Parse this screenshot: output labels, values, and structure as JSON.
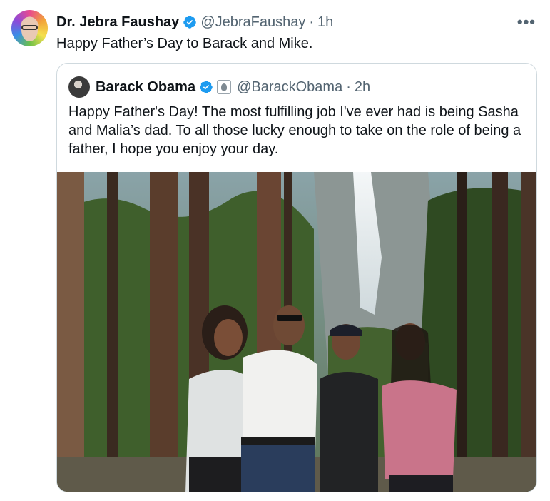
{
  "tweet": {
    "author_name": "Dr. Jebra Faushay",
    "handle": "@JebraFaushay",
    "separator": "·",
    "time": "1h",
    "text": "Happy Father’s Day to Barack and Mike.",
    "more_label": "•••"
  },
  "quoted": {
    "author_name": "Barack Obama",
    "handle": "@BarackObama",
    "separator": "·",
    "time": "2h",
    "text": "Happy Father's Day! The most fulfilling job I've ever had is being Sasha and Malia’s dad. To all those lucky enough to take on the role of being a father, I hope you enjoy your day."
  },
  "colors": {
    "verified": "#1d9bf0",
    "muted": "#536471",
    "border": "#cfd9de"
  },
  "icons": [
    "verified-badge-icon",
    "government-seal-icon",
    "more-options-icon"
  ]
}
